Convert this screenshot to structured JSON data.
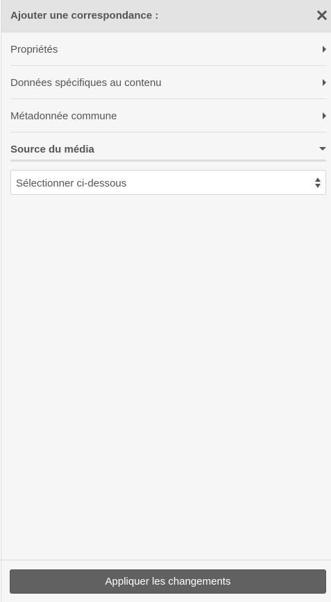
{
  "header": {
    "title": "Ajouter une correspondance :",
    "close_icon": "close-icon"
  },
  "sections": [
    {
      "label": "Propriétés",
      "state": "collapsed",
      "icon": "caret-right-icon"
    },
    {
      "label": "Données spécifiques au contenu",
      "state": "collapsed",
      "icon": "caret-right-icon"
    },
    {
      "label": "Métadonnée commune",
      "state": "collapsed",
      "icon": "caret-right-icon"
    },
    {
      "label": "Source du média",
      "state": "expanded",
      "icon": "caret-down-icon"
    }
  ],
  "media_source": {
    "select_value": "Sélectionner ci-dessous"
  },
  "footer": {
    "apply_label": "Appliquer les changements"
  },
  "colors": {
    "header_bg": "#e3e3e3",
    "panel_bg": "#f6f6f6",
    "button_bg": "#616161",
    "text": "#555555"
  }
}
